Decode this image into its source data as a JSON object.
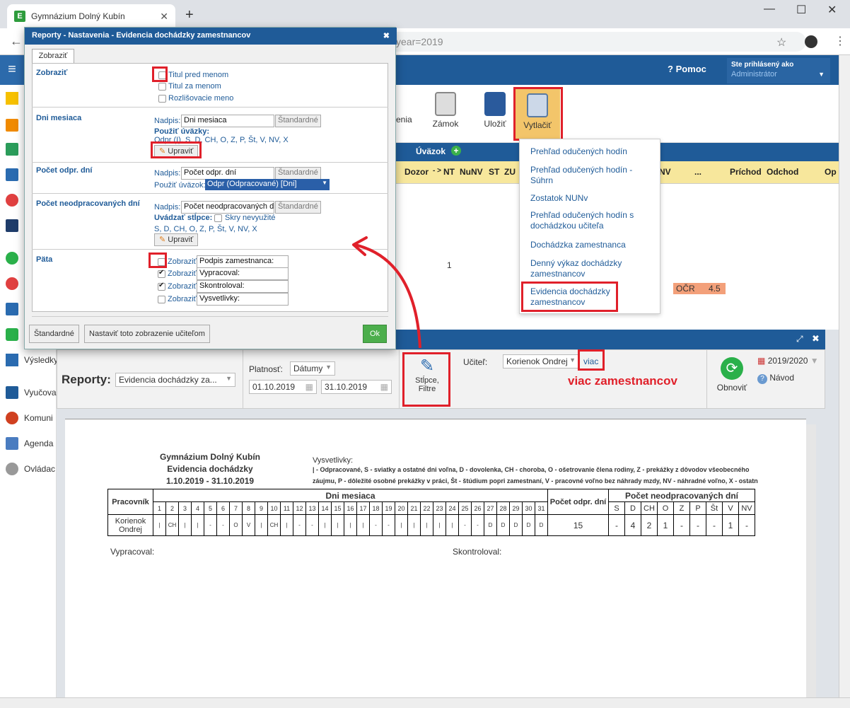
{
  "browser": {
    "tab_title": "Gymnázium Dolný Kubín",
    "url_partial": "year=2019",
    "new_tab": "+",
    "close": "✕"
  },
  "header": {
    "help": "Pomoc",
    "logged_as": "Ste prihlásený ako",
    "user": "Administrátor"
  },
  "sidebar": {
    "items": [
      {
        "label": "Výsledky"
      },
      {
        "label": "Vyučova"
      },
      {
        "label": "Komuni"
      },
      {
        "label": "Agenda"
      },
      {
        "label": "Ovládac"
      }
    ]
  },
  "toolbar": {
    "items": [
      {
        "label": "enia"
      },
      {
        "label": "Zámok"
      },
      {
        "label": "Uložiť"
      },
      {
        "label": "Vytlačiť"
      }
    ]
  },
  "grid": {
    "group_header": "Úväzok",
    "cols": [
      "Dozor",
      "- >",
      "NT",
      "NuNV",
      "ST",
      "ZU",
      "NV",
      "...",
      "Príchod",
      "Odchod",
      "Op"
    ],
    "val1": "1",
    "ocr": "OČR",
    "ocr_val": "4.5"
  },
  "dropdown": {
    "items": [
      "Prehľad odučených hodín",
      "Prehľad odučených hodín - Súhrn",
      "Zostatok NUNv",
      "Prehľad odučených hodín s dochádzkou učiteľa",
      "Dochádzka zamestnanca",
      "Denný výkaz dochádzky zamestnancov",
      "Evidencia dochádzky zamestnancov"
    ]
  },
  "report": {
    "label": "Reporty:",
    "type": "Evidencia dochádzky za...",
    "platnost_label": "Platnosť:",
    "platnost": "Dátumy",
    "date_from": "01.10.2019",
    "date_to": "31.10.2019",
    "columns_btn": "Stĺpce, Filtre",
    "ucitel_label": "Učiteľ:",
    "ucitel": "Korienok Ondrej",
    "viac": "viac",
    "annotation": "viac zamestnancov",
    "refresh": "Obnoviť",
    "year": "2019/2020",
    "help": "Návod"
  },
  "doc": {
    "school": "Gymnázium Dolný Kubín",
    "title": "Evidencia dochádzky",
    "period": "1.10.2019 - 31.10.2019",
    "legend_title": "Vysvetlivky:",
    "legend1": "| - Odpracované, S - sviatky a ostatné dni voľna, D - dovolenka, CH - choroba, O - ošetrovanie člena rodiny, Z - prekážky z dôvodov všeobecného",
    "legend2": "záujmu, P - dôležité osobné prekážky v práci, Št - štúdium popri zamestnaní, V - pracovné voľno bez náhrady mzdy, NV - náhradné voľno, X - ostatn",
    "col_worker": "Pracovník",
    "col_days": "Dni mesiaca",
    "col_count": "Počet odpr. dní",
    "col_neodpr": "Počet neodpracovaných dní",
    "days": [
      "1",
      "2",
      "3",
      "4",
      "5",
      "6",
      "7",
      "8",
      "9",
      "10",
      "11",
      "12",
      "13",
      "14",
      "15",
      "16",
      "17",
      "18",
      "19",
      "20",
      "21",
      "22",
      "23",
      "24",
      "25",
      "26",
      "27",
      "28",
      "29",
      "30",
      "31"
    ],
    "worker": "Korienok Ondrej",
    "marks": [
      "|",
      "CH",
      "|",
      "|",
      "-",
      "-",
      "O",
      "V",
      "|",
      "CH",
      "|",
      "-",
      "-",
      "|",
      "|",
      "|",
      "|",
      "-",
      "-",
      "|",
      "|",
      "|",
      "|",
      "|",
      "-",
      "-",
      "D",
      "D",
      "D",
      "D",
      "D"
    ],
    "count": "15",
    "neodpr_heads": [
      "S",
      "D",
      "CH",
      "O",
      "Z",
      "P",
      "Št",
      "V",
      "NV"
    ],
    "neodpr_vals": [
      "-",
      "4",
      "2",
      "1",
      "-",
      "-",
      "-",
      "1",
      "-"
    ],
    "vypracoval": "Vypracoval:",
    "skontroloval": "Skontroloval:"
  },
  "modal": {
    "title": "Reporty - Nastavenia - Evidencia dochádzky zamestnancov",
    "tab": "Zobraziť",
    "s1": "Zobraziť",
    "titul_pred": "Titul pred menom",
    "titul_za": "Titul za menom",
    "rozlis": "Rozlišovacie meno",
    "s2": "Dni mesiaca",
    "nadpis": "Nadpis:",
    "dni_val": "Dni mesiaca",
    "std": "Štandardné",
    "pouzit_uv": "Použiť úväzky:",
    "uv_list": "Odpr (I), S, D, CH, O, Z, P, Št, V, NV, X",
    "upravit": "Upraviť",
    "s3": "Počet odpr. dní",
    "odpr_val": "Počet odpr. dní",
    "pouzit_uvazok": "Použiť úväzok:",
    "uvazok_sel": "Odpr (Odpracované) [Dni]",
    "s4": "Počet neodpracovaných dní",
    "neodpr_val": "Počet neodpracovaných dn",
    "uvadzat": "Uvádzať stĺpce:",
    "skry": "Skry nevyužité",
    "stlpce": "S, D, CH, O, Z, P, Št, V, NV, X",
    "s5": "Päta",
    "zobrazit": "Zobraziť",
    "p1": "Podpis zamestnanca:",
    "p2": "Vypracoval:",
    "p3": "Skontroloval:",
    "p4": "Vysvetlivky:",
    "btn_std": "Štandardné",
    "btn_teacher": "Nastaviť toto zobrazenie učiteľom",
    "btn_ok": "Ok"
  }
}
